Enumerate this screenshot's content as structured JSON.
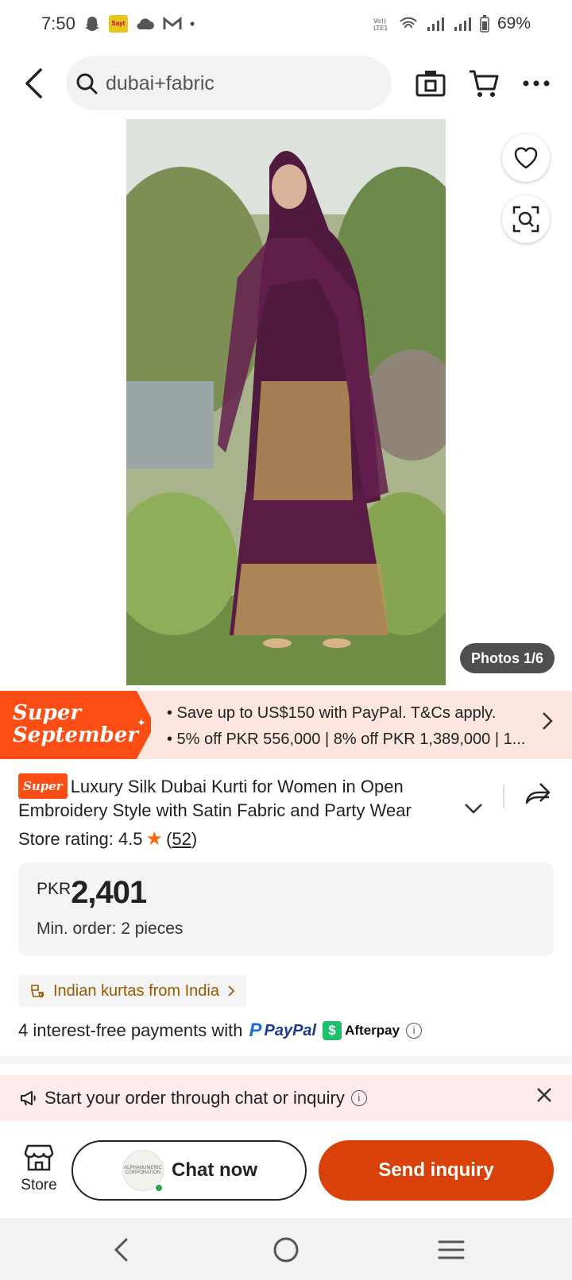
{
  "status_bar": {
    "time": "7:50",
    "app_icon_text": "Sayt",
    "battery": "69%"
  },
  "search": {
    "value": "dubai+fabric"
  },
  "gallery": {
    "photo_counter": "Photos 1/6"
  },
  "promo": {
    "badge_line1": "Super",
    "badge_line2": "September",
    "line1": "• Save up to US$150 with PayPal. T&Cs apply.",
    "line2": "• 5% off PKR 556,000 | 8% off PKR 1,389,000 | 1..."
  },
  "product": {
    "badge": "Super",
    "title": "Luxury Silk Dubai Kurti for Women in Open Embroidery Style with Satin Fabric and Party Wear",
    "rating_label": "Store rating: 4.5",
    "rating_open": "(",
    "rating_count": "52",
    "rating_close": ")",
    "price_currency": "PKR",
    "price_value": "2,401",
    "min_order": "Min. order: 2 pieces",
    "origin": "Indian kurtas from India",
    "payments_text": "4 interest-free payments with",
    "paypal": "PayPal",
    "afterpay": "Afterpay"
  },
  "chat_banner": {
    "text": "Start your order through chat or inquiry"
  },
  "actions": {
    "store_label": "Store",
    "supplier_avatar_text": "ALPHANUMERIC CORPORATION",
    "chat_label": "Chat now",
    "inquiry_label": "Send inquiry"
  },
  "colors": {
    "accent": "#d94109",
    "promo_orange": "#fb4d14",
    "promo_bg": "#fde6e0",
    "rating_star": "#f96a0d",
    "afterpay_green": "#1ebf6b"
  },
  "icons": [
    "back-icon",
    "search-icon",
    "camera-icon",
    "cart-icon",
    "more-icon",
    "heart-icon",
    "visual-search-icon",
    "share-icon",
    "chevron-down-icon",
    "star-icon",
    "ship-icon",
    "info-icon",
    "megaphone-icon",
    "close-icon",
    "store-icon"
  ]
}
